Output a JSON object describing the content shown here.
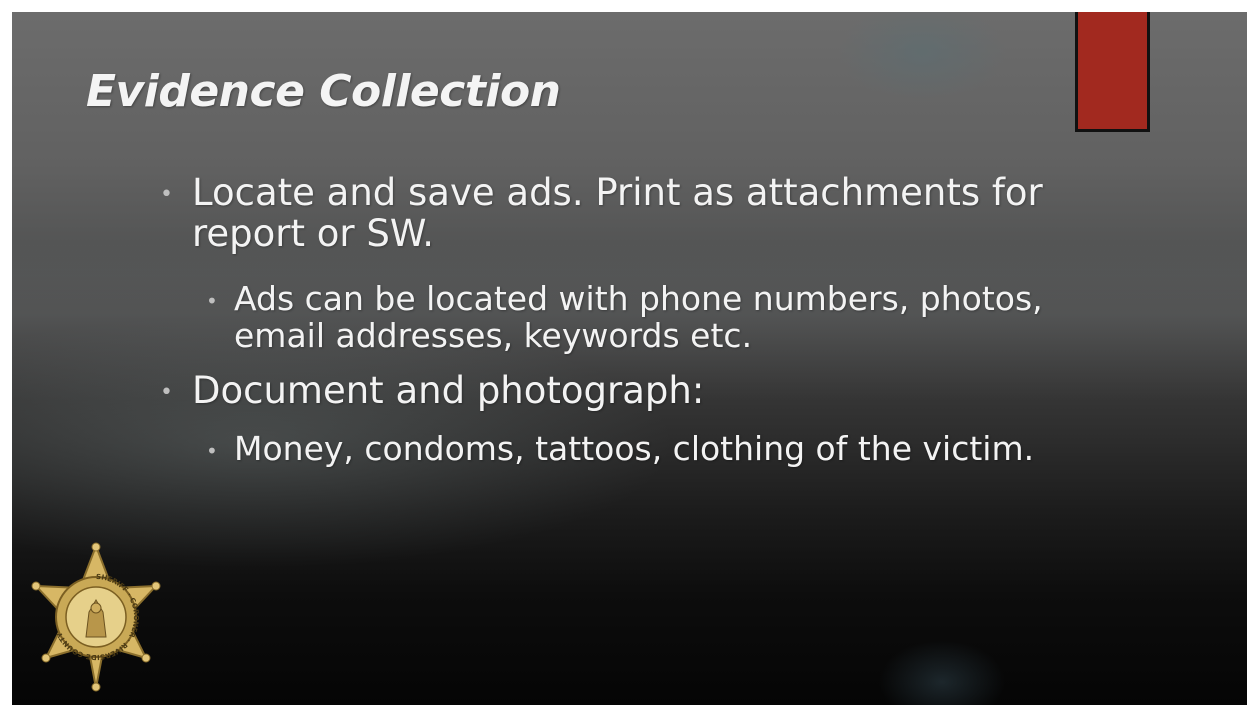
{
  "slide": {
    "title": "Evidence Collection",
    "bullets": [
      {
        "level": 1,
        "text": "Locate and save ads. Print as attachments for report or SW."
      },
      {
        "level": 2,
        "text": "Ads can be located with phone numbers, photos, email addresses, keywords etc."
      },
      {
        "level": 1,
        "text": "Document and photograph:"
      },
      {
        "level": 2,
        "text": "Money, condoms, tattoos, clothing of the victim."
      }
    ],
    "logo": {
      "icon": "sheriff-star-badge-icon",
      "ring_text": "SHERIFF · CORONER · RIVERSIDE COUNTY"
    },
    "colors": {
      "accent": "#a2291f",
      "text": "#f3f3f3",
      "badge_gold": "#d7b765"
    }
  }
}
